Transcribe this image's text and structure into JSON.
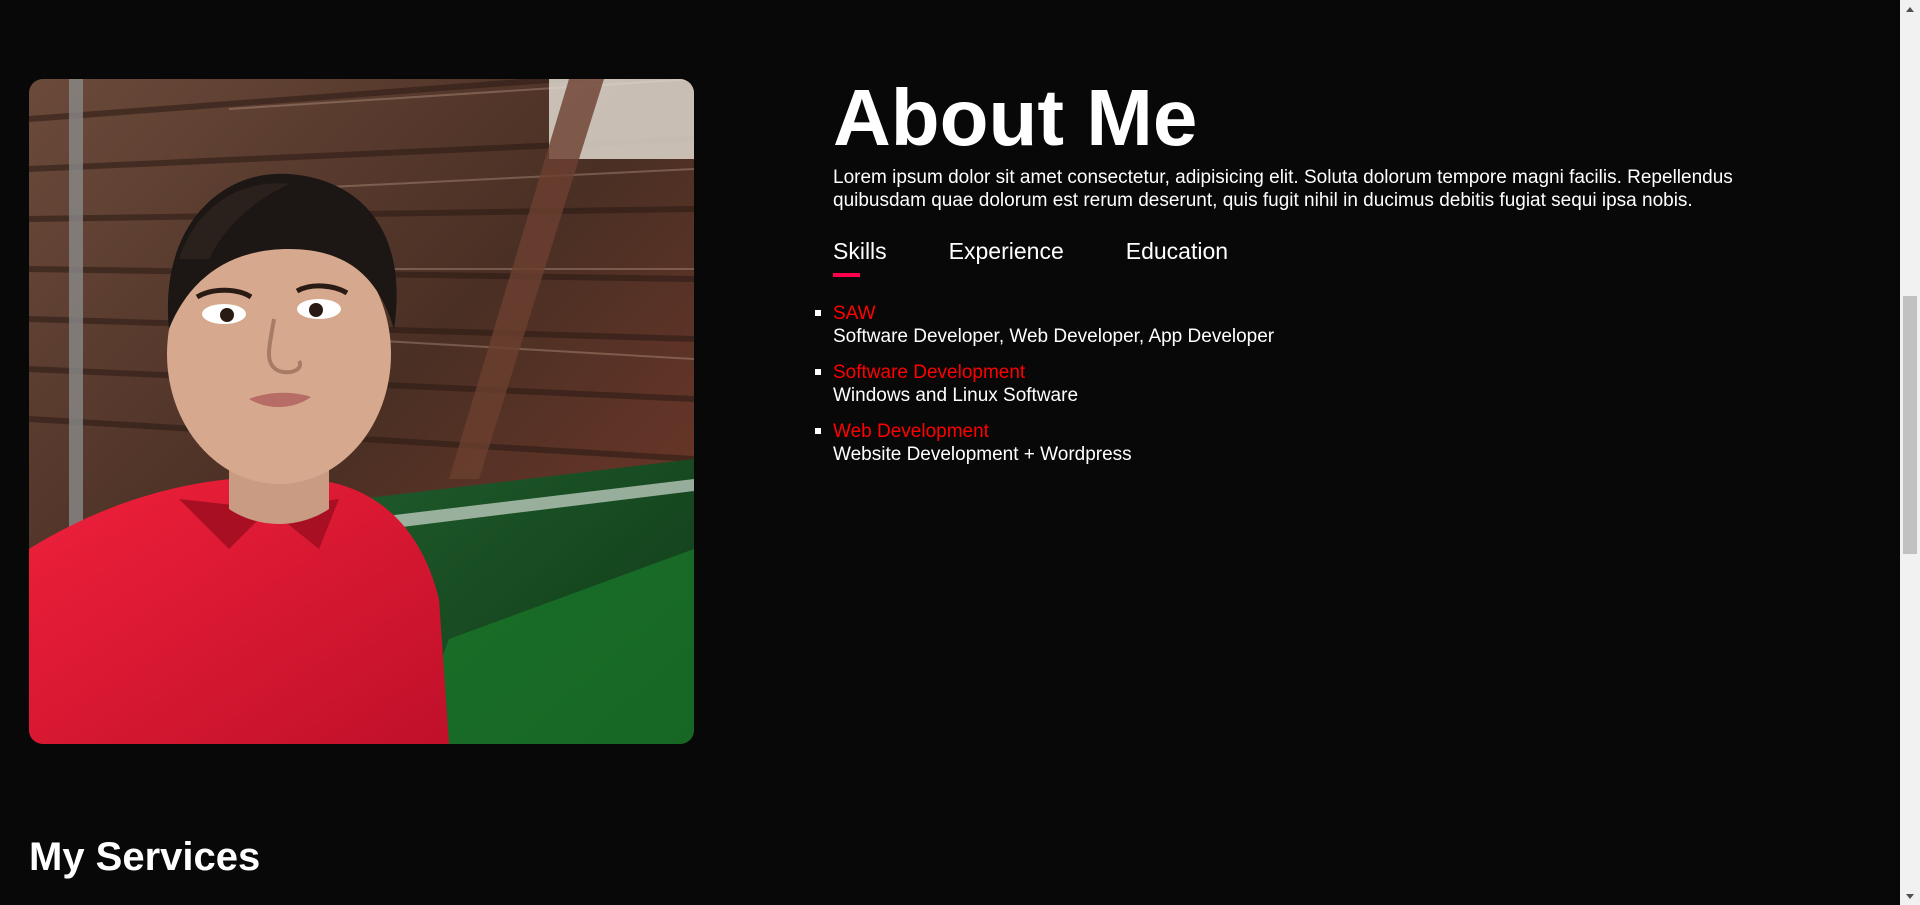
{
  "about": {
    "title": "About Me",
    "text": "Lorem ipsum dolor sit amet consectetur, adipisicing elit. Soluta dolorum tempore magni facilis. Repellendus quibusdam quae dolorum est rerum deserunt, quis fugit nihil in ducimus debitis fugiat sequi ipsa nobis.",
    "tabs": [
      {
        "label": "Skills",
        "active": true
      },
      {
        "label": "Experience",
        "active": false
      },
      {
        "label": "Education",
        "active": false
      }
    ],
    "skills": [
      {
        "name": "SAW",
        "desc": "Software Developer, Web Developer, App Developer"
      },
      {
        "name": "Software Development",
        "desc": "Windows and Linux Software"
      },
      {
        "name": "Web Development",
        "desc": "Website Development + Wordpress"
      }
    ]
  },
  "photo": {
    "icon": "profile-photo"
  },
  "services": {
    "title": "My Services"
  },
  "colors": {
    "background": "#080808",
    "accent": "#ff004f",
    "skill_name": "#ff0000",
    "text": "#ffffff"
  }
}
